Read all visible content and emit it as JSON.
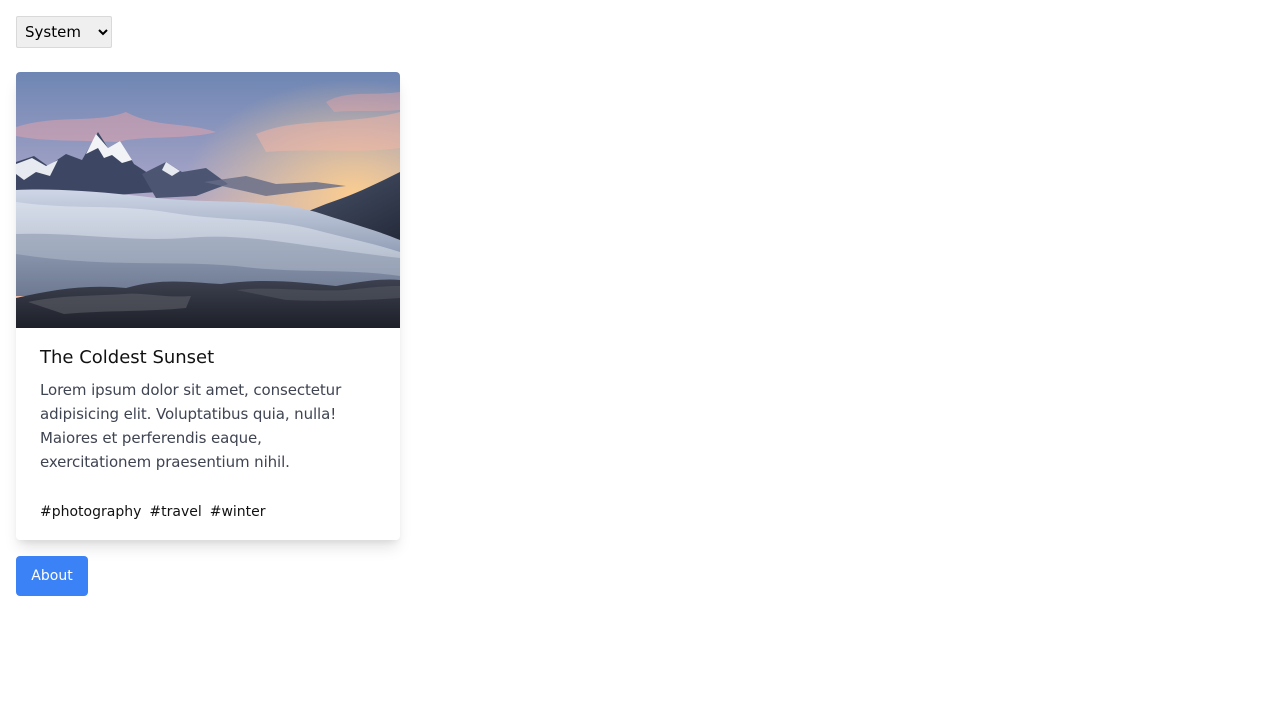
{
  "controls": {
    "theme_select": {
      "selected": "System",
      "options": [
        "System"
      ]
    }
  },
  "card": {
    "image_icon": "mountain-sunset-photo",
    "title": "The Coldest Sunset",
    "description": "Lorem ipsum dolor sit amet, consectetur adipisicing elit. Voluptatibus quia, nulla! Maiores et perferendis eaque, exercitationem praesentium nihil.",
    "tags": [
      "#photography",
      "#travel",
      "#winter"
    ]
  },
  "actions": {
    "about_label": "About"
  },
  "colors": {
    "accent": "#3b82f6",
    "body_text": "#3f4452",
    "select_background": "#efefef"
  }
}
